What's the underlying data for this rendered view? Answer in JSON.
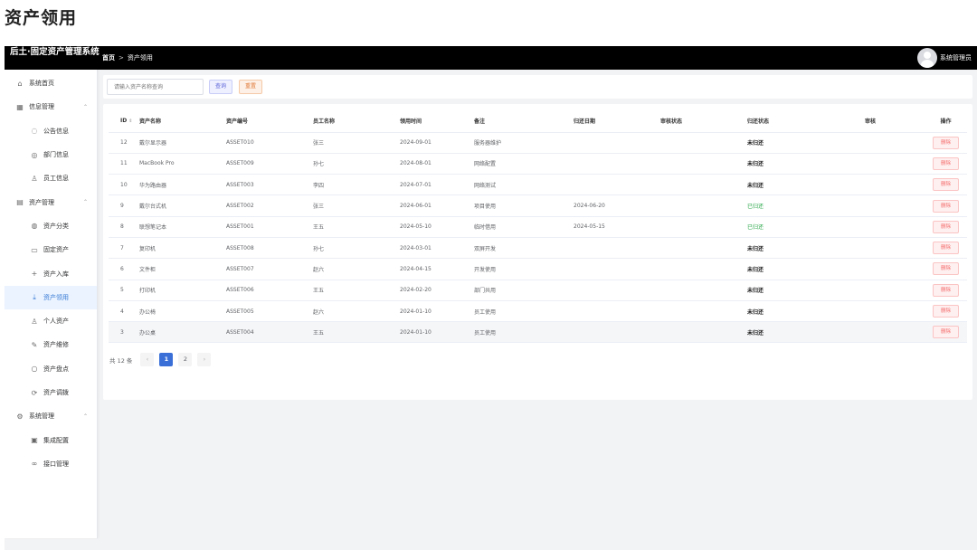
{
  "page_heading": "资产领用",
  "topbar": {
    "brand": "后土·固定资产管理系统",
    "breadcrumb": {
      "home": "首页",
      "separator": ">",
      "current": "资产领用"
    },
    "user_name": "系统管理员"
  },
  "sidebar": {
    "items": [
      {
        "label": "系统首页",
        "icon": "home-icon",
        "glyph": "⌂",
        "level": 1
      },
      {
        "label": "信息管理",
        "icon": "grid-icon",
        "glyph": "▦",
        "level": 1,
        "arrow": "⌃"
      },
      {
        "label": "公告信息",
        "icon": "chat-icon",
        "glyph": "◌",
        "level": 2
      },
      {
        "label": "部门信息",
        "icon": "eye-icon",
        "glyph": "◎",
        "level": 2
      },
      {
        "label": "员工信息",
        "icon": "user-icon",
        "glyph": "♙",
        "level": 2
      },
      {
        "label": "资产管理",
        "icon": "bank-icon",
        "glyph": "▤",
        "level": 1,
        "arrow": "⌃"
      },
      {
        "label": "资产分类",
        "icon": "globe-icon",
        "glyph": "◍",
        "level": 2
      },
      {
        "label": "固定资产",
        "icon": "document-icon",
        "glyph": "▭",
        "level": 2
      },
      {
        "label": "资产入库",
        "icon": "plus-icon",
        "glyph": "+",
        "level": 2
      },
      {
        "label": "资产领用",
        "icon": "download-icon",
        "glyph": "⤓",
        "level": 2,
        "active": true
      },
      {
        "label": "个人资产",
        "icon": "person-icon",
        "glyph": "♙",
        "level": 2
      },
      {
        "label": "资产维修",
        "icon": "edit-icon",
        "glyph": "✎",
        "level": 2
      },
      {
        "label": "资产盘点",
        "icon": "search-icon",
        "glyph": "○",
        "level": 2
      },
      {
        "label": "资产调拨",
        "icon": "refresh-icon",
        "glyph": "⟳",
        "level": 2
      },
      {
        "label": "系统管理",
        "icon": "gear-icon",
        "glyph": "⚙",
        "level": 1,
        "arrow": "⌃"
      },
      {
        "label": "集成配置",
        "icon": "cards-icon",
        "glyph": "▣",
        "level": 2
      },
      {
        "label": "接口管理",
        "icon": "link-icon",
        "glyph": "∞",
        "level": 2
      }
    ]
  },
  "search": {
    "placeholder": "请输入资产名称查询",
    "query_label": "查询",
    "reset_label": "重置"
  },
  "table": {
    "columns": [
      "ID",
      "资产名称",
      "资产编号",
      "员工名称",
      "领用时间",
      "备注",
      "归还日期",
      "审核状态",
      "归还状态",
      "审核",
      "操作"
    ],
    "sort_glyph": "⇕",
    "delete_label": "删除",
    "rows": [
      {
        "id": "12",
        "name": "戴尔显示器",
        "code": "ASSET010",
        "employee": "张三",
        "date": "2024-09-01",
        "note": "服务器维护",
        "return_date": "",
        "audit_status": "",
        "return_status": "未归还",
        "returned": false
      },
      {
        "id": "11",
        "name": "MacBook Pro",
        "code": "ASSET009",
        "employee": "孙七",
        "date": "2024-08-01",
        "note": "网络配置",
        "return_date": "",
        "audit_status": "",
        "return_status": "未归还",
        "returned": false
      },
      {
        "id": "10",
        "name": "华为路由器",
        "code": "ASSET003",
        "employee": "李四",
        "date": "2024-07-01",
        "note": "网络测试",
        "return_date": "",
        "audit_status": "",
        "return_status": "未归还",
        "returned": false
      },
      {
        "id": "9",
        "name": "戴尔台式机",
        "code": "ASSET002",
        "employee": "张三",
        "date": "2024-06-01",
        "note": "项目使用",
        "return_date": "2024-06-20",
        "audit_status": "",
        "return_status": "已归还",
        "returned": true
      },
      {
        "id": "8",
        "name": "联想笔记本",
        "code": "ASSET001",
        "employee": "王五",
        "date": "2024-05-10",
        "note": "临时借用",
        "return_date": "2024-05-15",
        "audit_status": "",
        "return_status": "已归还",
        "returned": true
      },
      {
        "id": "7",
        "name": "复印机",
        "code": "ASSET008",
        "employee": "孙七",
        "date": "2024-03-01",
        "note": "双屏开发",
        "return_date": "",
        "audit_status": "",
        "return_status": "未归还",
        "returned": false
      },
      {
        "id": "6",
        "name": "文件柜",
        "code": "ASSET007",
        "employee": "赵六",
        "date": "2024-04-15",
        "note": "开发使用",
        "return_date": "",
        "audit_status": "",
        "return_status": "未归还",
        "returned": false
      },
      {
        "id": "5",
        "name": "打印机",
        "code": "ASSET006",
        "employee": "王五",
        "date": "2024-02-20",
        "note": "部门共用",
        "return_date": "",
        "audit_status": "",
        "return_status": "未归还",
        "returned": false
      },
      {
        "id": "4",
        "name": "办公椅",
        "code": "ASSET005",
        "employee": "赵六",
        "date": "2024-01-10",
        "note": "员工使用",
        "return_date": "",
        "audit_status": "",
        "return_status": "未归还",
        "returned": false
      },
      {
        "id": "3",
        "name": "办公桌",
        "code": "ASSET004",
        "employee": "王五",
        "date": "2024-01-10",
        "note": "员工使用",
        "return_date": "",
        "audit_status": "",
        "return_status": "未归还",
        "returned": false,
        "highlighted": true
      }
    ]
  },
  "pagination": {
    "total_text": "共 12 条",
    "prev": "‹",
    "next": "›",
    "pages": [
      "1",
      "2"
    ],
    "current": "1"
  }
}
